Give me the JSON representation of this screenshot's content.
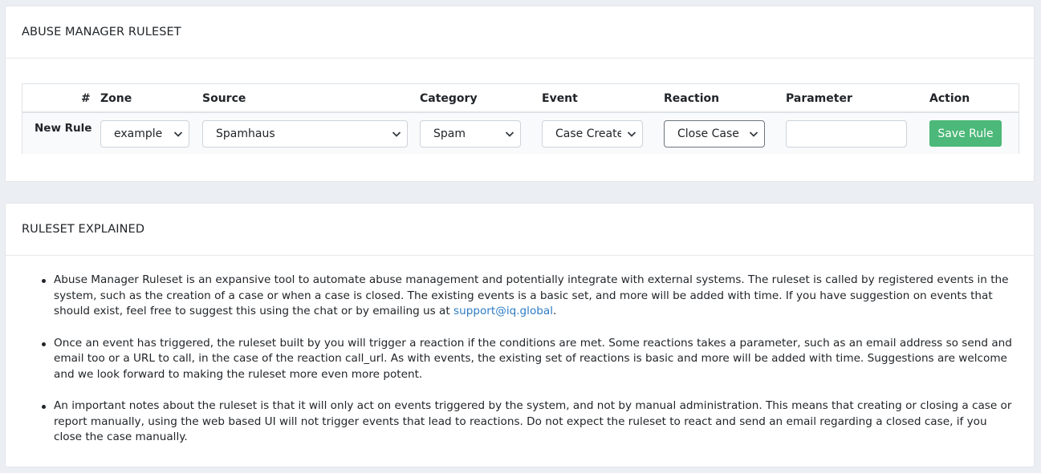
{
  "ruleset_card": {
    "title": "ABUSE MANAGER RULESET",
    "columns": [
      "#",
      "Zone",
      "Source",
      "Category",
      "Event",
      "Reaction",
      "Parameter",
      "Action"
    ],
    "new_rule": {
      "row_label": "New Rule",
      "zone": "example",
      "source": "Spamhaus",
      "category": "Spam",
      "event": "Case Created",
      "reaction": "Close Case",
      "parameter_value": "",
      "save_label": "Save Rule"
    }
  },
  "explained_card": {
    "title": "RULESET EXPLAINED",
    "paragraphs": {
      "p1_before_link": "Abuse Manager Ruleset is an expansive tool to automate abuse management and potentially integrate with external systems. The ruleset is called by registered events in the system, such as the creation of a case or when a case is closed. The existing events is a basic set, and more will be added with time. If you have suggestion on events that should exist, feel free to suggest this using the chat or by emailing us at ",
      "p1_link": "support@iq.global",
      "p1_after_link": ".",
      "p2": "Once an event has triggered, the ruleset built by you will trigger a reaction if the conditions are met. Some reactions takes a parameter, such as an email address so send and email too or a URL to call, in the case of the reaction call_url. As with events, the existing set of reactions is basic and more will be added with time. Suggestions are welcome and we look forward to making the ruleset more even more potent.",
      "p3": "An important notes about the ruleset is that it will only act on events triggered by the system, and not by manual administration. This means that creating or closing a case or report manually, using the web based UI will not trigger events that lead to reactions. Do not expect the ruleset to react and send an email regarding a closed case, if you close the case manually."
    }
  },
  "colors": {
    "background": "#ebeef2",
    "save_button": "#4cb879",
    "link": "#2d7bc4"
  }
}
